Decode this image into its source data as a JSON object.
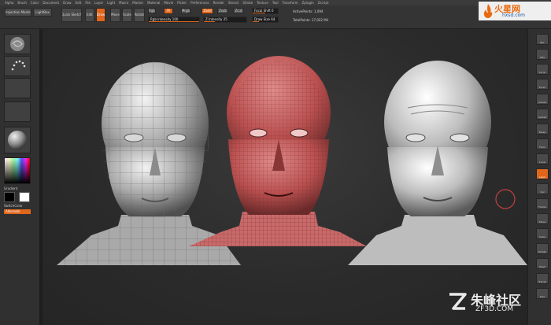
{
  "menu": [
    "Alpha",
    "Brush",
    "Color",
    "Document",
    "Draw",
    "Edit",
    "File",
    "Layer",
    "Light",
    "Macro",
    "Marker",
    "Material",
    "Movie",
    "Picker",
    "Preferences",
    "Render",
    "Stencil",
    "Stroke",
    "Texture",
    "Tool",
    "Transform",
    "Zplugin",
    "Zscript"
  ],
  "toolbar": {
    "projection_master": "Projection Master",
    "lightbox": "LightBox",
    "quick_sketch": "Quick Sketch",
    "edit": "Edit",
    "draw": "Draw",
    "move": "Move",
    "scale": "Scale",
    "rotate": "Rotate",
    "rgb": "Rgb",
    "m": "M",
    "mrgb": "Mrgb",
    "zadd": "Zadd",
    "zsub": "Zsub",
    "zcut": "Zcut",
    "rgb_intensity": "Rgb Intensity 100",
    "z_intensity": "Z Intensity 25",
    "focal_shift": "Focal Shift 0",
    "draw_size": "Draw Size 64",
    "active_points": "ActivePoints: 1,094",
    "total_points": "TotalPoints: 17,022 Mil",
    "rgb_intensity_level": 1.0,
    "z_intensity_level": 0.25,
    "focal_shift_level": 0.5,
    "draw_size_level": 0.25
  },
  "left_panel": {
    "gradient": "Gradient",
    "switch_color": "SwitchColor",
    "alternate": "Alternate"
  },
  "right_panel": [
    "Bpr",
    "SPix",
    "Scroll",
    "Zoom",
    "Actual",
    "AAHalf",
    "Persp",
    "Floor",
    "Local",
    "Lsym",
    "Xyz",
    "Frame",
    "Move",
    "Scale",
    "Rotate",
    "PolyF",
    "Transp",
    "Solo"
  ],
  "logo": {
    "main": "火星网",
    "sub": "hxsd.com"
  },
  "watermark": {
    "main": "朱峰社区",
    "sub": "ZF3D.COM"
  },
  "colors": {
    "accent": "#e0661b",
    "mesh_red": "#c85a5a"
  }
}
